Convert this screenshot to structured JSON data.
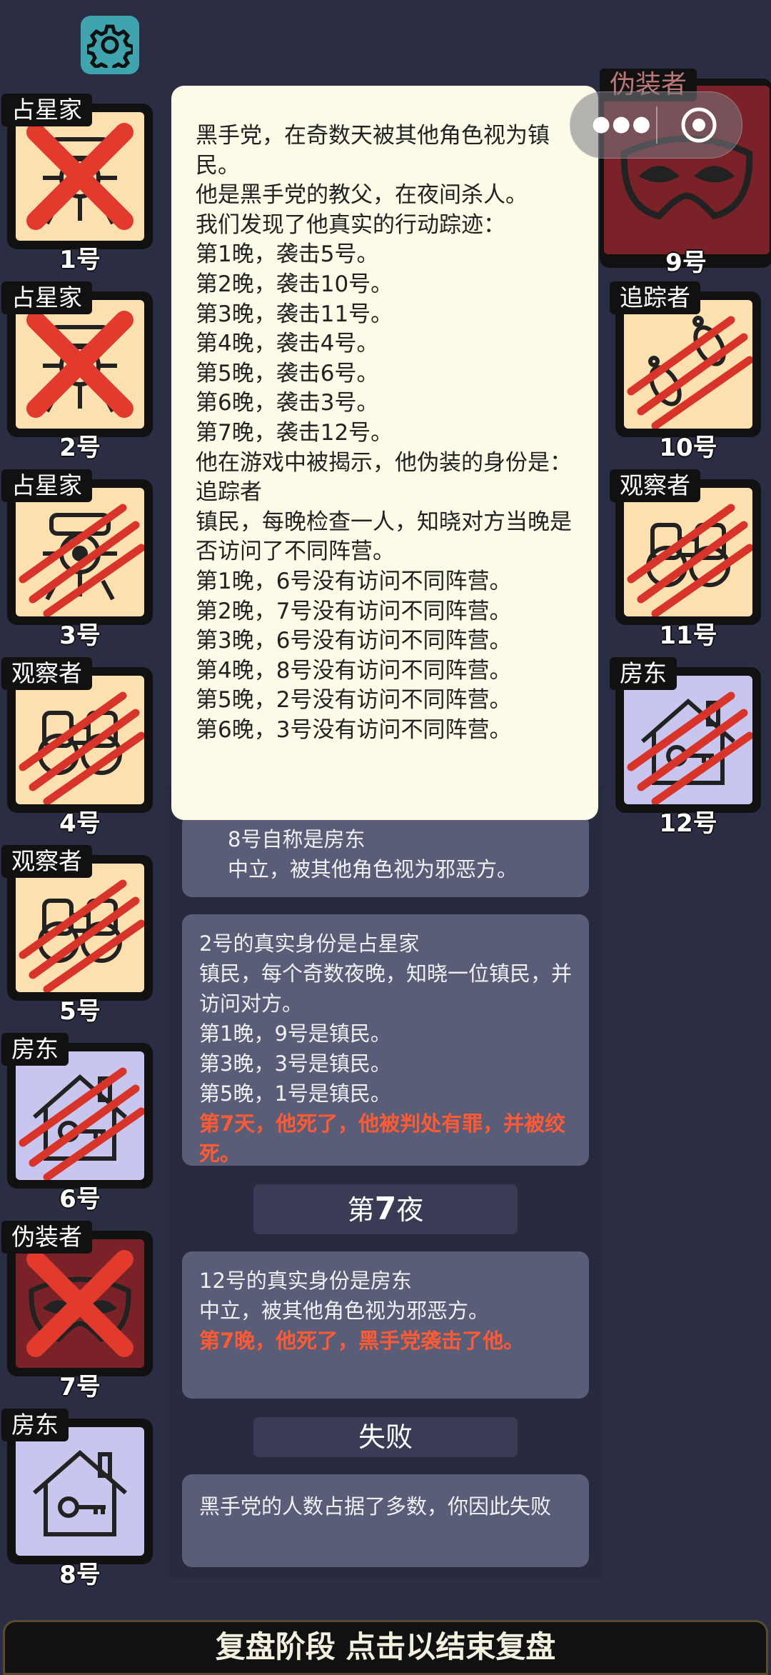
{
  "settings_icon": "gear-icon",
  "left_players": [
    {
      "role": "占星家",
      "num": "1号",
      "status": "executed",
      "icon": "clockwork-icon"
    },
    {
      "role": "占星家",
      "num": "2号",
      "status": "executed",
      "icon": "clockwork-icon"
    },
    {
      "role": "占星家",
      "num": "3号",
      "status": "attacked",
      "icon": "clockwork-icon"
    },
    {
      "role": "观察者",
      "num": "4号",
      "status": "attacked",
      "icon": "binoculars-icon"
    },
    {
      "role": "观察者",
      "num": "5号",
      "status": "attacked",
      "icon": "binoculars-icon"
    },
    {
      "role": "房东",
      "num": "6号",
      "status": "attacked",
      "icon": "house-key-icon"
    },
    {
      "role": "伪装者",
      "num": "7号",
      "status": "executed",
      "icon": "mask-icon"
    },
    {
      "role": "房东",
      "num": "8号",
      "status": "alive",
      "icon": "house-key-icon"
    }
  ],
  "right_players": [
    {
      "role": "伪装者",
      "num": "9号",
      "status": "alive",
      "icon": "mask-icon"
    },
    {
      "role": "追踪者",
      "num": "10号",
      "status": "attacked",
      "icon": "footprints-icon"
    },
    {
      "role": "观察者",
      "num": "11号",
      "status": "attacked",
      "icon": "binoculars-icon"
    },
    {
      "role": "房东",
      "num": "12号",
      "status": "attacked",
      "icon": "house-key-icon"
    }
  ],
  "tooltip_lines": [
    "黑手党，在奇数天被其他角色视为镇民。",
    "他是黑手党的教父，在夜间杀人。",
    "我们发现了他真实的行动踪迹：",
    "第1晚，袭击5号。",
    "第2晚，袭击10号。",
    "第3晚，袭击11号。",
    "第4晚，袭击4号。",
    "第5晚，袭击6号。",
    "第6晚，袭击3号。",
    "第7晚，袭击12号。",
    "他在游戏中被揭示，他伪装的身份是：追踪者",
    "镇民，每晚检查一人，知晓对方当晚是否访问了不同阵营。",
    "第1晚，6号没有访问不同阵营。",
    "第2晚，7号没有访问不同阵营。",
    "第3晚，6号没有访问不同阵营。",
    "第4晚，8号没有访问不同阵营。",
    "第5晚，2号没有访问不同阵营。",
    "第6晚，3号没有访问不同阵营。"
  ],
  "log_partial": [
    "8号自称是房东",
    "中立，被其他角色视为邪恶方。"
  ],
  "log_2": {
    "lines": [
      "2号的真实身份是占星家",
      "镇民，每个奇数夜晚，知晓一位镇民，并访问对方。",
      "第1晚，9号是镇民。",
      "第3晚，3号是镇民。",
      "第5晚，1号是镇民。"
    ],
    "death": "第7天，他死了，他被判处有罪，并被绞死。"
  },
  "phase_night": {
    "prefix": "第",
    "num": "7",
    "suffix": "夜"
  },
  "log_12": {
    "lines": [
      "12号的真实身份是房东",
      "中立，被其他角色视为邪恶方。"
    ],
    "death": "第7晚，他死了，黑手党袭击了他。"
  },
  "phase_result": "失败",
  "result_text": "黑手党的人数占据了多数，你因此失败",
  "bottom_bar": "复盘阶段 点击以结束复盘",
  "colors": {
    "accent_red": "#ff5a33",
    "bg": "#2b2d45",
    "tooltip": "#fcfbe8"
  }
}
